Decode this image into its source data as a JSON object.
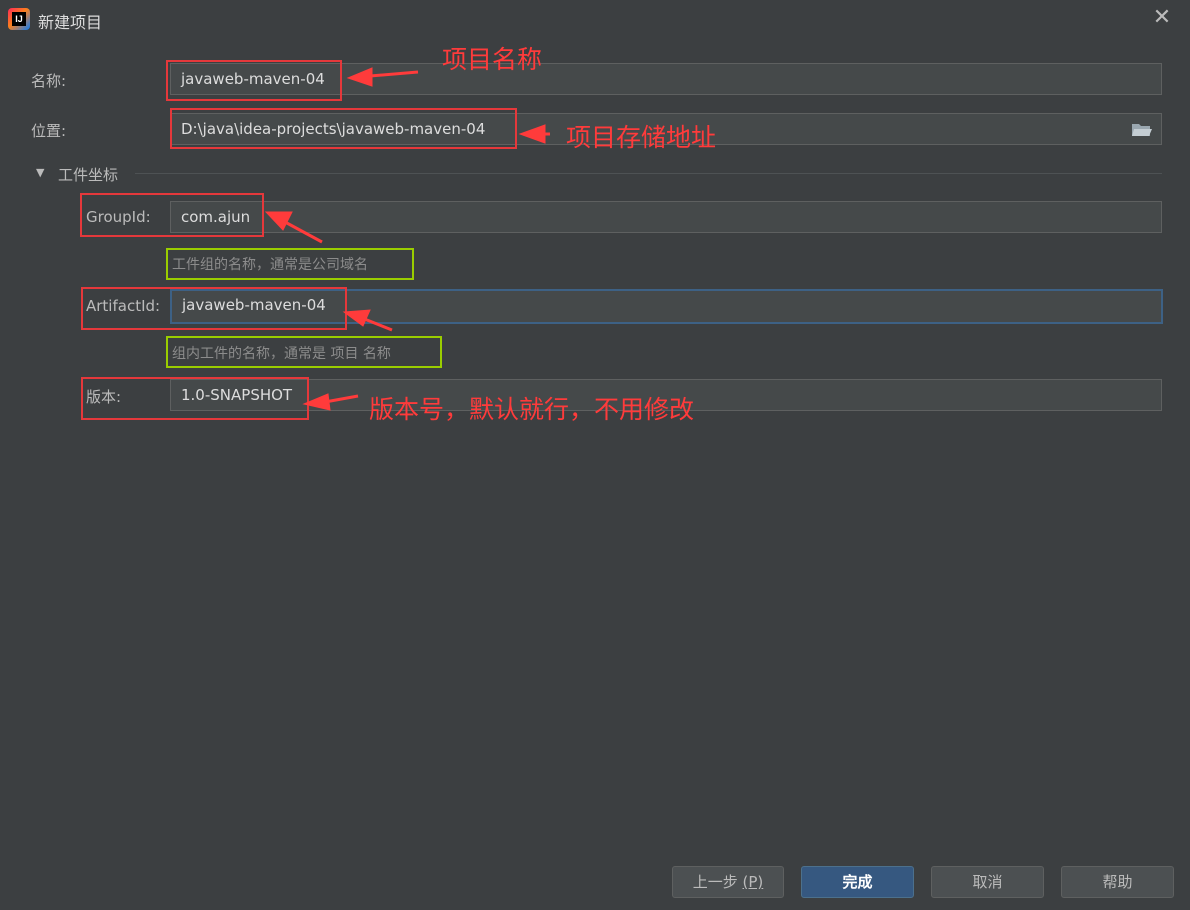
{
  "window": {
    "title": "新建项目",
    "close_icon": "close-icon"
  },
  "form": {
    "name": {
      "label": "名称:",
      "value": "javaweb-maven-04"
    },
    "location": {
      "label": "位置:",
      "value": "D:\\java\\idea-projects\\javaweb-maven-04",
      "browse_icon": "folder-icon"
    },
    "coords_section": {
      "label": "工件坐标",
      "expanded": true
    },
    "groupid": {
      "label": "GroupId:",
      "value": "com.ajun",
      "hint": "工件组的名称，通常是公司域名"
    },
    "artifactid": {
      "label": "ArtifactId:",
      "value": "javaweb-maven-04",
      "hint": "组内工件的名称，通常是 项目 名称"
    },
    "version": {
      "label": "版本:",
      "value": "1.0-SNAPSHOT"
    }
  },
  "annotations": {
    "name_note": "项目名称",
    "location_note": "项目存储地址",
    "version_note": "版本号，默认就行，不用修改"
  },
  "footer": {
    "prev": {
      "label": "上一步 ",
      "mnemonic": "(P)"
    },
    "finish": "完成",
    "cancel": "取消",
    "help": "帮助"
  },
  "colors": {
    "annotation_red": "#e5383b",
    "annotation_green": "#9acd00",
    "primary_button": "#365880",
    "focus_border": "#3d6185"
  }
}
